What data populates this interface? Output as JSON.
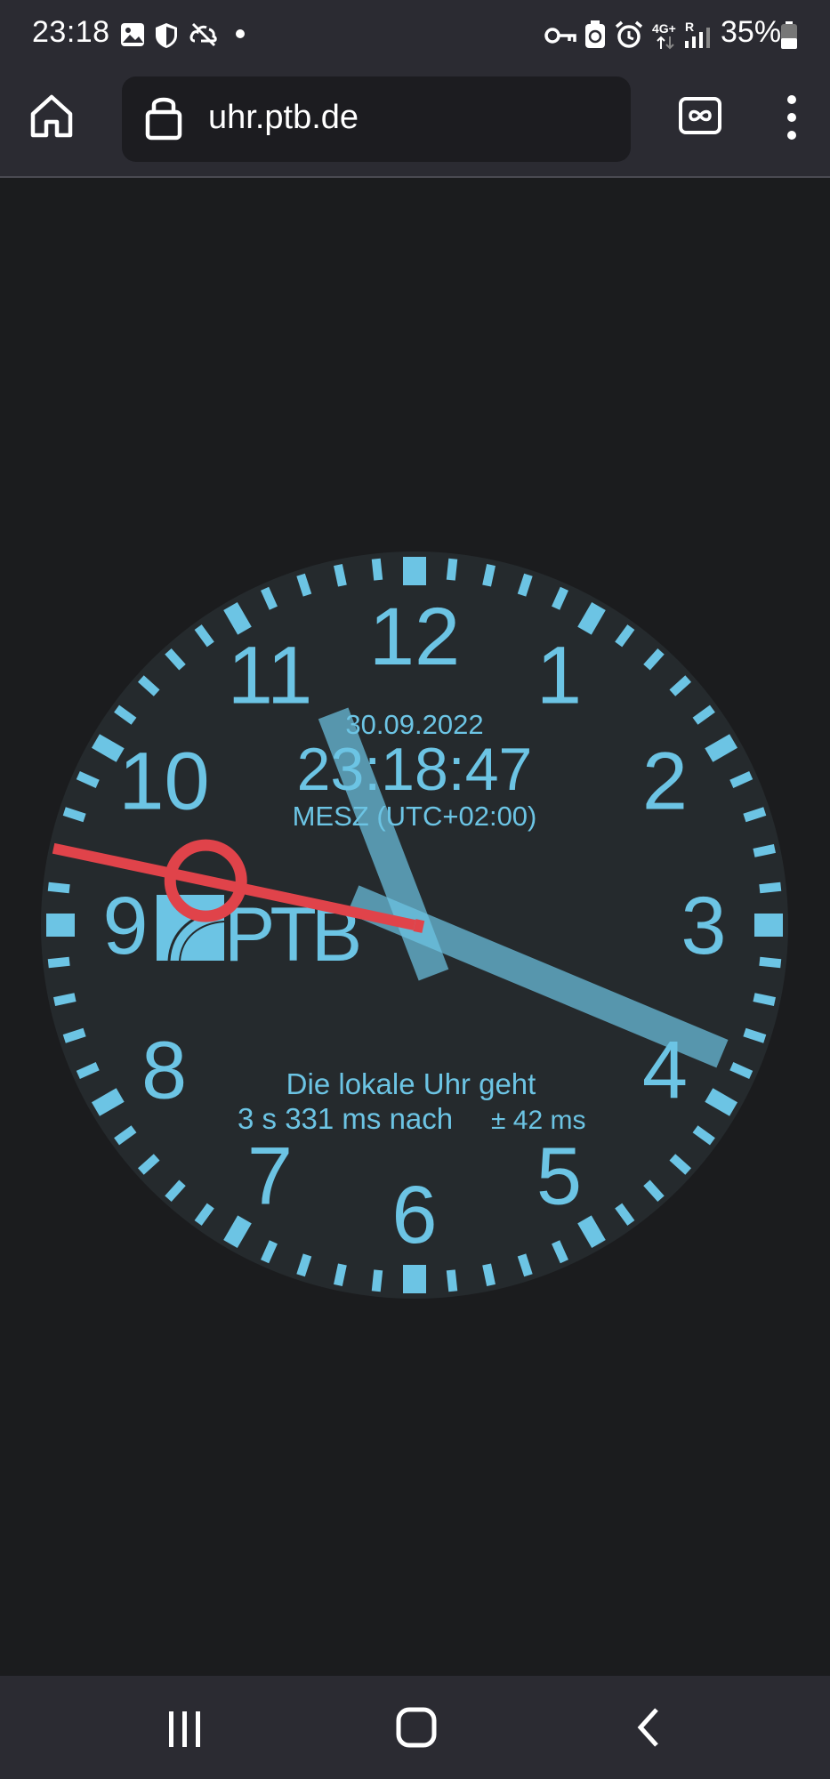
{
  "status_bar": {
    "time": "23:18",
    "battery_percent": "35%",
    "network_label": "4G+",
    "roaming_label": "R",
    "left_icons": [
      "gallery-icon",
      "shield-icon",
      "sync-off-icon",
      "notification-dot-icon"
    ],
    "right_icons": [
      "vpn-key-icon",
      "recycle-icon",
      "alarm-icon",
      "network-icon",
      "signal-icon",
      "battery-icon"
    ]
  },
  "browser": {
    "url": "uhr.ptb.de",
    "buttons": [
      "home-button",
      "lock-icon",
      "tab-switcher-button",
      "menu-button"
    ]
  },
  "clock": {
    "date": "30.09.2022",
    "time": "23:18:47",
    "timezone": "MESZ (UTC+02:00)",
    "hours": 23,
    "minutes": 18,
    "seconds": 47,
    "numerals": [
      "12",
      "1",
      "2",
      "3",
      "4",
      "5",
      "6",
      "7",
      "8",
      "9",
      "10",
      "11"
    ],
    "logo_text": "PTB",
    "offset_line1": "Die lokale Uhr geht",
    "offset_line2": "3 s 331 ms nach",
    "offset_uncertainty": "± 42 ms",
    "colors": {
      "accent": "#6cc4e4",
      "face": "#252a2d",
      "second_hand": "#e0434a",
      "hand": "#6cc4e4"
    }
  },
  "nav_bar": {
    "buttons": [
      "recent-apps-button",
      "home-nav-button",
      "back-button"
    ]
  }
}
